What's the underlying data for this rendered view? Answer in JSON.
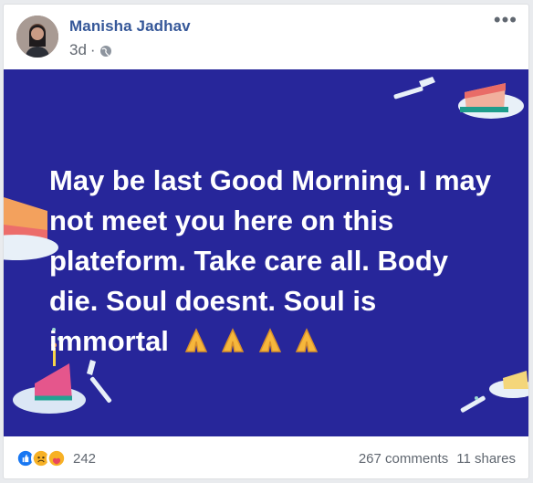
{
  "post": {
    "author": "Manisha Jadhav",
    "time": "3d",
    "separator": "·",
    "more_icon": "ellipsis-icon",
    "privacy_icon": "globe-icon",
    "image_text": "May be last Good Morning. I may not meet you here on this plateform. Take care all. Body die. Soul doesnt. Soul is immortal",
    "emoji_count": 4,
    "background_color": "#27269a"
  },
  "footer": {
    "reaction_count": "242",
    "comments": "267 comments",
    "shares": "11 shares",
    "reactions": [
      "like-icon",
      "sad-icon",
      "care-icon"
    ]
  }
}
